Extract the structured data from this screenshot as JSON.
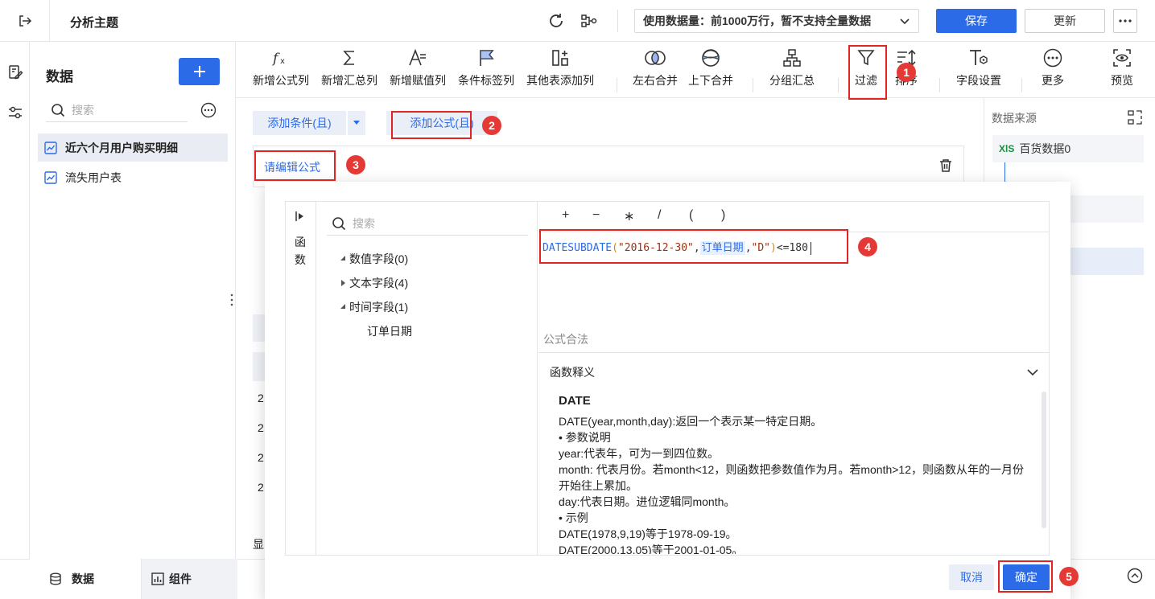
{
  "header": {
    "title": "分析主题",
    "data_limit": "使用数据量：前1000万行，暂不支持全量数据",
    "save_label": "保存",
    "update_label": "更新"
  },
  "data_panel": {
    "title": "数据",
    "search_placeholder": "搜索",
    "items": [
      {
        "label": "近六个月用户购买明细"
      },
      {
        "label": "流失用户表"
      }
    ]
  },
  "bottom_tabs": {
    "data": "数据",
    "component": "组件"
  },
  "toolbar": {
    "items": [
      {
        "label": "新增公式列",
        "icon": "fx-icon"
      },
      {
        "label": "新增汇总列",
        "icon": "sigma-icon"
      },
      {
        "label": "新增赋值列",
        "icon": "assign-icon"
      },
      {
        "label": "条件标签列",
        "icon": "flag-icon"
      },
      {
        "label": "其他表添加列",
        "icon": "add-column-icon"
      },
      {
        "label": "左右合并",
        "icon": "merge-lr-icon"
      },
      {
        "label": "上下合并",
        "icon": "merge-tb-icon"
      },
      {
        "label": "分组汇总",
        "icon": "group-icon"
      },
      {
        "label": "过滤",
        "icon": "filter-icon"
      },
      {
        "label": "排序",
        "icon": "sort-icon"
      },
      {
        "label": "字段设置",
        "icon": "field-settings-icon"
      },
      {
        "label": "更多",
        "icon": "more-icon"
      },
      {
        "label": "预览",
        "icon": "preview-icon"
      }
    ]
  },
  "filter": {
    "add_condition": "添加条件(且)",
    "add_formula": "添加公式(且)",
    "edit_formula": "请编辑公式"
  },
  "right_panel": {
    "title": "数据来源",
    "source": "百货数据0",
    "source_badge": "XlS"
  },
  "workspace": {
    "row_prefix": "2",
    "bottom_text": "显"
  },
  "dialog": {
    "function_label": "函数",
    "search_placeholder": "搜索",
    "fields": [
      {
        "label": "数值字段(0)"
      },
      {
        "label": "文本字段(4)"
      },
      {
        "label": "时间字段(1)"
      }
    ],
    "time_field": "订单日期",
    "operators": [
      "+",
      "−",
      "∗",
      "/",
      "(",
      ")"
    ],
    "formula": {
      "fn": "DATESUBDATE",
      "open": "(",
      "arg1": "\"2016-12-30\"",
      "comma1": ",",
      "field": "订单日期",
      "comma2": ",",
      "arg3": "\"D\"",
      "close": ")",
      "tail": "<=180"
    },
    "status": "公式合法",
    "explain_header": "函数释义",
    "explain": {
      "title": "DATE",
      "lines": [
        "DATE(year,month,day):返回一个表示某一特定日期。",
        "• 参数说明",
        "year:代表年，可为一到四位数。",
        "month: 代表月份。若month<12，则函数把参数值作为月。若month>12，则函数从年的一月份开始往上累加。",
        "day:代表日期。进位逻辑同month。",
        "• 示例",
        "DATE(1978,9,19)等于1978-09-19。",
        "DATE(2000,13,05)等于2001-01-05。"
      ]
    },
    "cancel_label": "取消",
    "confirm_label": "确定"
  },
  "annotations": [
    "1",
    "2",
    "3",
    "4",
    "5"
  ],
  "colors": {
    "accent": "#2c6be8",
    "highlight": "#e02424",
    "badge": "#e53935"
  }
}
